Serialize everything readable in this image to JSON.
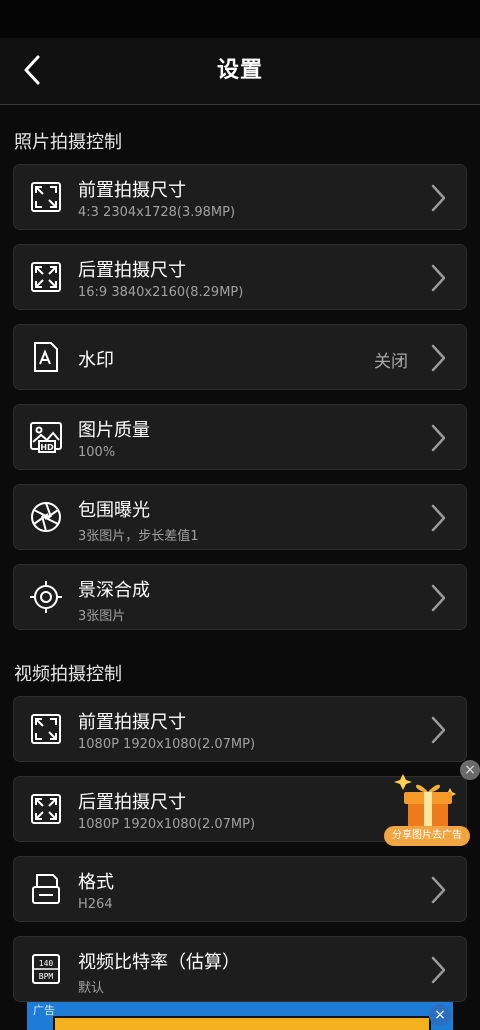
{
  "header": {
    "title": "设置"
  },
  "photo_section": {
    "title": "照片拍摄控制",
    "items": [
      {
        "icon": "expand-icon",
        "title": "前置拍摄尺寸",
        "subtitle": "4:3  2304x1728(3.98MP)"
      },
      {
        "icon": "expand-icon",
        "title": "后置拍摄尺寸",
        "subtitle": "16:9  3840x2160(8.29MP)"
      },
      {
        "icon": "watermark-icon",
        "title": "水印",
        "value": "关闭"
      },
      {
        "icon": "hd-image-icon",
        "title": "图片质量",
        "subtitle": "100%"
      },
      {
        "icon": "aperture-icon",
        "title": "包围曝光",
        "subtitle": "3张图片，步长差值1"
      },
      {
        "icon": "crosshair-icon",
        "title": "景深合成",
        "subtitle": "3张图片"
      }
    ]
  },
  "video_section": {
    "title": "视频拍摄控制",
    "items": [
      {
        "icon": "expand-icon",
        "title": "前置拍摄尺寸",
        "subtitle": "1080P  1920x1080(2.07MP)"
      },
      {
        "icon": "expand-icon",
        "title": "后置拍摄尺寸",
        "subtitle": "1080P  1920x1080(2.07MP)"
      },
      {
        "icon": "format-icon",
        "title": "格式",
        "subtitle": "H264"
      },
      {
        "icon": "bpm-icon",
        "title": "视频比特率（估算）",
        "subtitle": "默认",
        "icon_text_top": "140",
        "icon_text_bottom": "BPM"
      }
    ]
  },
  "ad_float": {
    "label": "分享图片去广告",
    "close": "×"
  },
  "ad_banner": {
    "tag": "广告",
    "close": "×"
  },
  "colors": {
    "background": "#0b0b0b",
    "card": "#1d1d1d",
    "ad_orange": "#f0a442"
  }
}
